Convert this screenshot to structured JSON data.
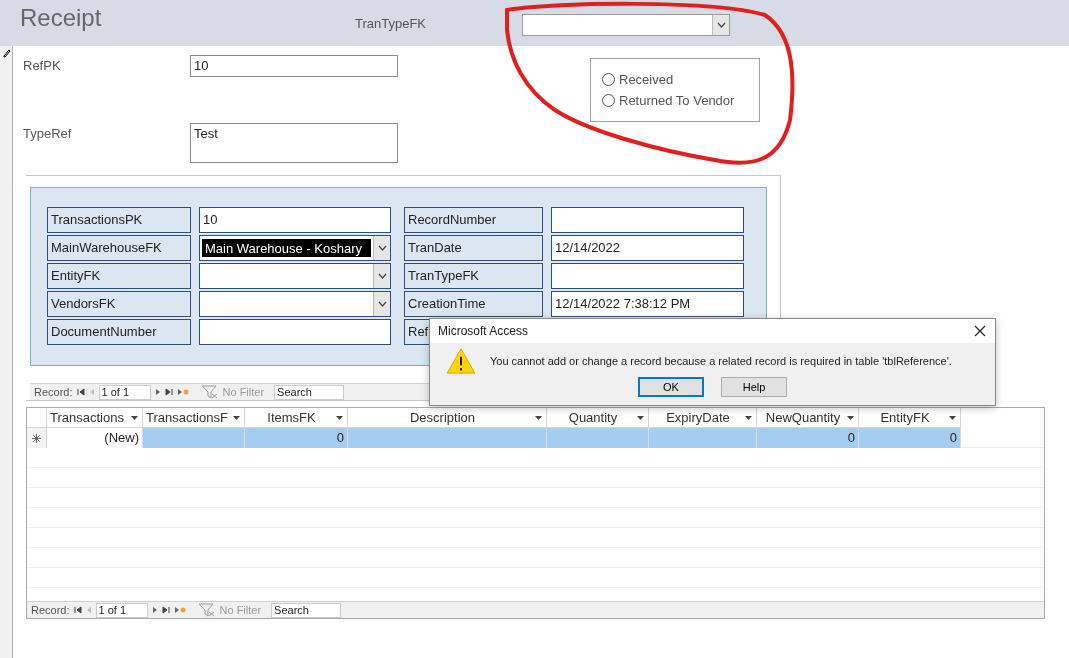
{
  "form": {
    "title": "Receipt",
    "header_label": "TranTypeFK"
  },
  "fields": [
    {
      "label": "RefPK",
      "value": "10",
      "kind": "single"
    },
    {
      "label": "TypeRef",
      "value": "Test",
      "kind": "multi"
    }
  ],
  "option_group": [
    {
      "label": "Received",
      "selected": false
    },
    {
      "label": "Returned To Vendor",
      "selected": false
    }
  ],
  "subform": {
    "fields": [
      {
        "label": "TransactionsPK",
        "value": "10",
        "kind": "text",
        "highlighted": false
      },
      {
        "label": "RecordNumber",
        "kind": "text",
        "highlighted": false
      },
      {
        "label": "MainWarehouseFK",
        "value": "Main Warehouse - Koshary",
        "kind": "combo",
        "highlighted": true
      },
      {
        "label": "TranDate",
        "value": "12/14/2022",
        "kind": "text",
        "highlighted": false
      },
      {
        "label": "EntityFK",
        "kind": "combo",
        "highlighted": false
      },
      {
        "label": "TranTypeFK",
        "kind": "text",
        "highlighted": false
      },
      {
        "label": "VendorsFK",
        "kind": "combo",
        "highlighted": false
      },
      {
        "label": "CreationTime",
        "value": "12/14/2022 7:38:12 PM",
        "kind": "text",
        "highlighted": false
      },
      {
        "label": "DocumentNumber",
        "kind": "text",
        "highlighted": false
      },
      {
        "label": "Ref",
        "kind": "text",
        "highlighted": false
      }
    ],
    "navigation": {
      "label": "Record:",
      "position": "1 of 1",
      "filter": "No Filter",
      "search_placeholder": "Search"
    }
  },
  "datasheet": {
    "columns": [
      "Transactions",
      "TransactionsF",
      "ItemsFK",
      "Description",
      "Quantity",
      "ExpiryDate",
      "NewQuantity",
      "EntityFK"
    ],
    "rows": [
      {
        "new": true,
        "selected": true,
        "cells": [
          "(New)",
          null,
          "0",
          null,
          null,
          null,
          "0",
          "0"
        ]
      }
    ],
    "navigation": {
      "label": "Record:",
      "position": "1 of 1",
      "filter": "No Filter",
      "search_placeholder": "Search"
    }
  },
  "dialog": {
    "title": "Microsoft Access",
    "message": "You cannot add or change a record because a related record is required in table 'tblReference'.",
    "buttons": [
      {
        "label": "OK",
        "selected": true
      },
      {
        "label": "Help",
        "selected": false
      }
    ]
  }
}
